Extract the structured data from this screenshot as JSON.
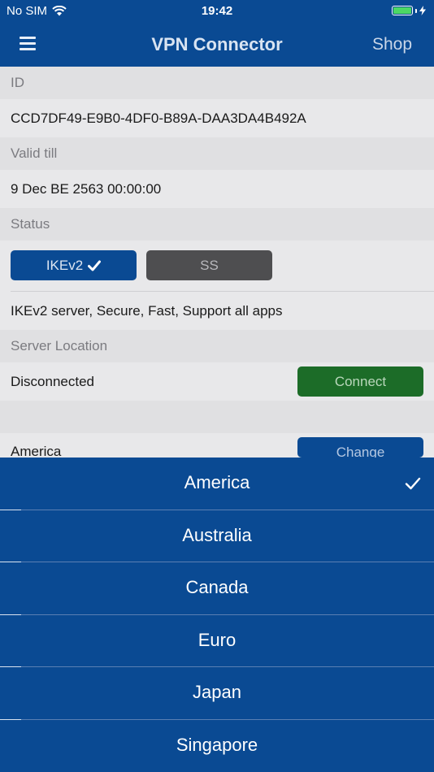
{
  "status_bar": {
    "carrier": "No SIM",
    "time": "19:42"
  },
  "nav": {
    "title": "VPN Connector",
    "shop_label": "Shop"
  },
  "fields": {
    "id_label": "ID",
    "id_value": "CCD7DF49-E9B0-4DF0-B89A-DAA3DA4B492A",
    "valid_label": "Valid till",
    "valid_value": "9 Dec BE 2563 00:00:00",
    "status_label": "Status"
  },
  "protocols": {
    "ikev2_label": "IKEv2",
    "ss_label": "SS",
    "selected": "IKEv2"
  },
  "protocol_description": "IKEv2 server, Secure, Fast, Support all apps",
  "server": {
    "section_label": "Server Location",
    "connection_status": "Disconnected",
    "connect_label": "Connect",
    "location": "America",
    "change_label": "Change"
  },
  "picker": {
    "selected": "America",
    "options": [
      "America",
      "Australia",
      "Canada",
      "Euro",
      "Japan",
      "Singapore"
    ]
  },
  "colors": {
    "brand_blue": "#0a4a93",
    "connect_green": "#1c6c28",
    "ss_gray": "#4e4e50"
  }
}
